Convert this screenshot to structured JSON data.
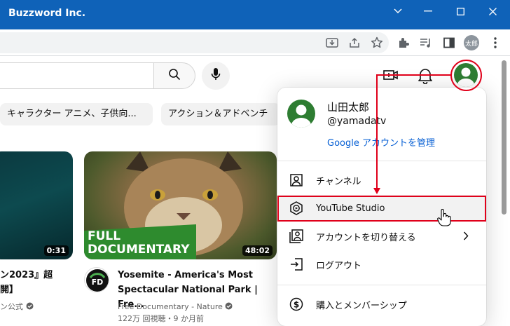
{
  "window": {
    "title": "Buzzword Inc."
  },
  "toolbar": {
    "profile_badge": "太郎"
  },
  "chips": [
    "キャラクター アニメ、子供向...",
    "アクション＆アドベンチ"
  ],
  "videos": [
    {
      "duration": "0:31",
      "title_line1": "ン2023』超",
      "title_line2": "開】",
      "channel": "ン公式"
    },
    {
      "duration": "48:02",
      "overlay_line1": "FULL",
      "overlay_line2": "DOCUMENTARY",
      "title_line1": "Yosemite - America's Most",
      "title_line2": "Spectacular National Park | Fre...",
      "channel": "Free Documentary - Nature",
      "stats": "122万 回視聴・9 か月前"
    }
  ],
  "account_menu": {
    "user_name": "山田太郎",
    "handle": "@yamadatv",
    "manage_link": "Google アカウントを管理",
    "items": [
      {
        "label": "チャンネル",
        "icon": "person-box-icon"
      },
      {
        "label": "YouTube Studio",
        "icon": "youtube-studio-icon"
      },
      {
        "label": "アカウントを切り替える",
        "icon": "switch-account-icon"
      },
      {
        "label": "ログアウト",
        "icon": "logout-icon"
      },
      {
        "label": "購入とメンバーシップ",
        "icon": "dollar-circle-icon"
      }
    ]
  },
  "colors": {
    "titlebar": "#0f62b8",
    "annotation": "#e0001a",
    "link": "#065fd4",
    "avatar": "#2e7d32"
  }
}
